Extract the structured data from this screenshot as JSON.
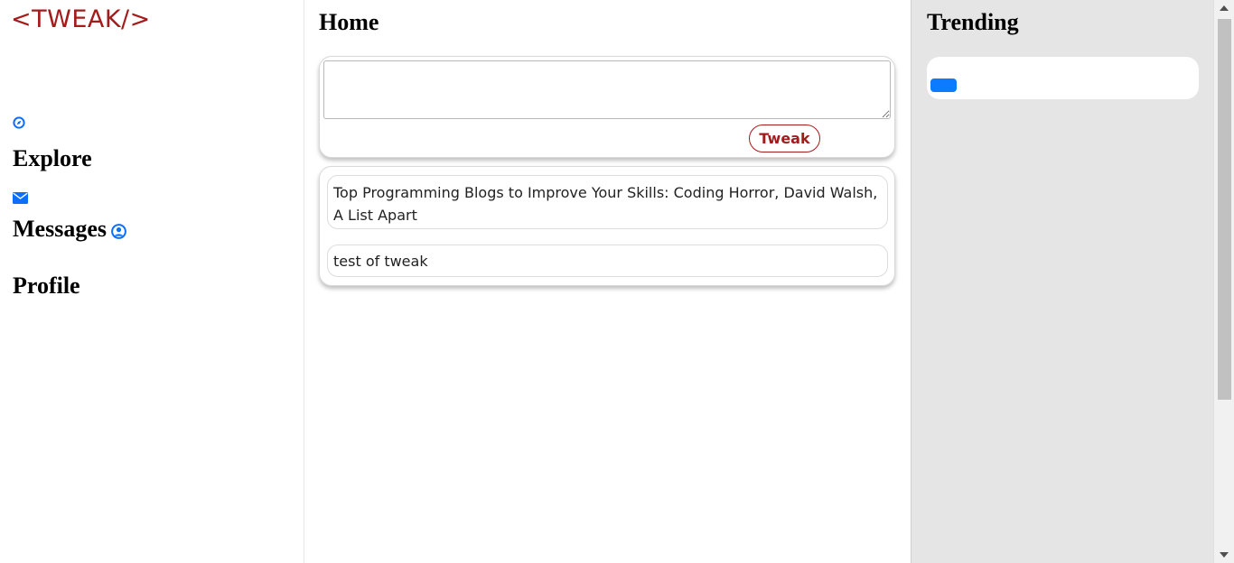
{
  "brand": {
    "logo": "<TWEAK/>"
  },
  "sidebar": {
    "items": [
      {
        "label": "Explore",
        "icon": "compass-icon"
      },
      {
        "label": "Messages",
        "icon": "envelope-icon"
      },
      {
        "label": "Profile",
        "icon": "user-circle-icon"
      }
    ]
  },
  "main": {
    "title": "Home",
    "compose": {
      "placeholder": "",
      "button_label": "Tweak"
    },
    "posts": [
      {
        "text": "Top Programming Blogs to Improve Your Skills: Coding Horror, David Walsh, A List Apart"
      },
      {
        "text": "test of tweak"
      }
    ]
  },
  "trending": {
    "title": "Trending",
    "button_label": ""
  },
  "colors": {
    "brand": "#a31b1b",
    "accent": "#0d6efd",
    "right_panel_bg": "#e5e5e5"
  }
}
